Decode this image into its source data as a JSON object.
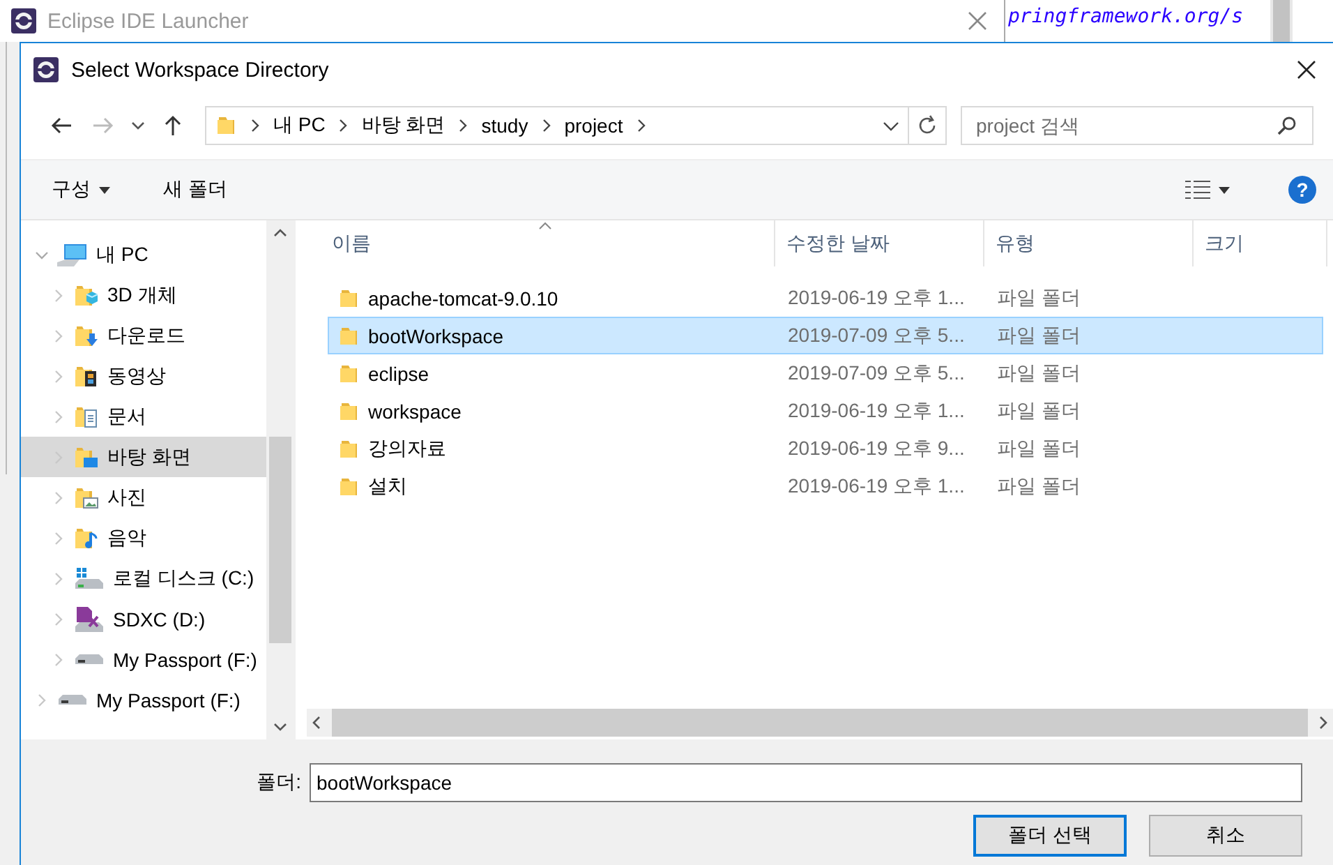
{
  "background": {
    "window_title": "Eclipse IDE Launcher",
    "editor_text": "pringframework.org/s"
  },
  "window": {
    "title": "Select Workspace Directory"
  },
  "address_bar": {
    "crumbs": [
      "내 PC",
      "바탕 화면",
      "study",
      "project"
    ]
  },
  "search": {
    "placeholder": "project 검색"
  },
  "toolbar": {
    "organize": "구성",
    "new_folder": "새 폴더",
    "help": "?"
  },
  "sidebar": {
    "items": [
      {
        "label": "내 PC",
        "kind": "computer",
        "expanded": true,
        "selected": false,
        "children": [
          {
            "label": "3D 개체",
            "kind": "objects3d",
            "expanded": false,
            "selected": false
          },
          {
            "label": "다운로드",
            "kind": "downloads",
            "expanded": false,
            "selected": false
          },
          {
            "label": "동영상",
            "kind": "videos",
            "expanded": false,
            "selected": false
          },
          {
            "label": "문서",
            "kind": "documents",
            "expanded": false,
            "selected": false
          },
          {
            "label": "바탕 화면",
            "kind": "desktop",
            "expanded": false,
            "selected": true
          },
          {
            "label": "사진",
            "kind": "pictures",
            "expanded": false,
            "selected": false
          },
          {
            "label": "음악",
            "kind": "music",
            "expanded": false,
            "selected": false
          },
          {
            "label": "로컬 디스크 (C:)",
            "kind": "system-drive",
            "expanded": false,
            "selected": false
          },
          {
            "label": "SDXC (D:)",
            "kind": "sd-card",
            "expanded": false,
            "selected": false
          },
          {
            "label": "My Passport (F:)",
            "kind": "drive",
            "expanded": false,
            "selected": false
          }
        ]
      },
      {
        "label": "My Passport (F:)",
        "kind": "drive",
        "expanded": false,
        "selected": false
      }
    ]
  },
  "file_list": {
    "columns": [
      "이름",
      "수정한 날짜",
      "유형",
      "크기"
    ],
    "rows": [
      {
        "name": "apache-tomcat-9.0.10",
        "modified": "2019-06-19 오후 1...",
        "type": "파일 폴더",
        "selected": false
      },
      {
        "name": "bootWorkspace",
        "modified": "2019-07-09 오후 5...",
        "type": "파일 폴더",
        "selected": true
      },
      {
        "name": "eclipse",
        "modified": "2019-07-09 오후 5...",
        "type": "파일 폴더",
        "selected": false
      },
      {
        "name": "workspace",
        "modified": "2019-06-19 오후 1...",
        "type": "파일 폴더",
        "selected": false
      },
      {
        "name": "강의자료",
        "modified": "2019-06-19 오후 9...",
        "type": "파일 폴더",
        "selected": false
      },
      {
        "name": "설치",
        "modified": "2019-06-19 오후 1...",
        "type": "파일 폴더",
        "selected": false
      }
    ]
  },
  "footer": {
    "folder_label": "폴더:",
    "folder_value": "bootWorkspace",
    "buttons": [
      {
        "label": "폴더 선택",
        "default": true
      },
      {
        "label": "취소",
        "default": false
      }
    ]
  }
}
